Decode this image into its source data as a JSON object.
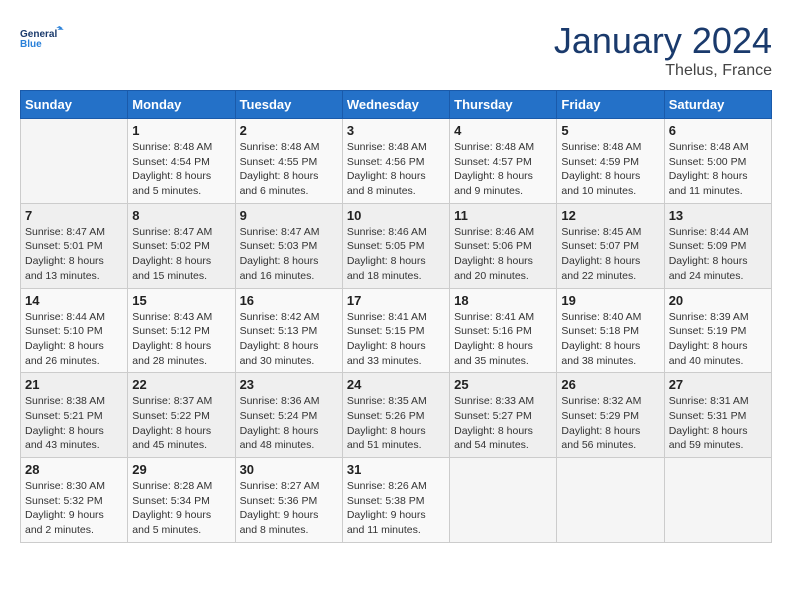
{
  "header": {
    "logo_line1": "General",
    "logo_line2": "Blue",
    "month": "January 2024",
    "location": "Thelus, France"
  },
  "weekdays": [
    "Sunday",
    "Monday",
    "Tuesday",
    "Wednesday",
    "Thursday",
    "Friday",
    "Saturday"
  ],
  "weeks": [
    [
      {
        "day": "",
        "sunrise": "",
        "sunset": "",
        "daylight": ""
      },
      {
        "day": "1",
        "sunrise": "Sunrise: 8:48 AM",
        "sunset": "Sunset: 4:54 PM",
        "daylight": "Daylight: 8 hours and 5 minutes."
      },
      {
        "day": "2",
        "sunrise": "Sunrise: 8:48 AM",
        "sunset": "Sunset: 4:55 PM",
        "daylight": "Daylight: 8 hours and 6 minutes."
      },
      {
        "day": "3",
        "sunrise": "Sunrise: 8:48 AM",
        "sunset": "Sunset: 4:56 PM",
        "daylight": "Daylight: 8 hours and 8 minutes."
      },
      {
        "day": "4",
        "sunrise": "Sunrise: 8:48 AM",
        "sunset": "Sunset: 4:57 PM",
        "daylight": "Daylight: 8 hours and 9 minutes."
      },
      {
        "day": "5",
        "sunrise": "Sunrise: 8:48 AM",
        "sunset": "Sunset: 4:59 PM",
        "daylight": "Daylight: 8 hours and 10 minutes."
      },
      {
        "day": "6",
        "sunrise": "Sunrise: 8:48 AM",
        "sunset": "Sunset: 5:00 PM",
        "daylight": "Daylight: 8 hours and 11 minutes."
      }
    ],
    [
      {
        "day": "7",
        "sunrise": "Sunrise: 8:47 AM",
        "sunset": "Sunset: 5:01 PM",
        "daylight": "Daylight: 8 hours and 13 minutes."
      },
      {
        "day": "8",
        "sunrise": "Sunrise: 8:47 AM",
        "sunset": "Sunset: 5:02 PM",
        "daylight": "Daylight: 8 hours and 15 minutes."
      },
      {
        "day": "9",
        "sunrise": "Sunrise: 8:47 AM",
        "sunset": "Sunset: 5:03 PM",
        "daylight": "Daylight: 8 hours and 16 minutes."
      },
      {
        "day": "10",
        "sunrise": "Sunrise: 8:46 AM",
        "sunset": "Sunset: 5:05 PM",
        "daylight": "Daylight: 8 hours and 18 minutes."
      },
      {
        "day": "11",
        "sunrise": "Sunrise: 8:46 AM",
        "sunset": "Sunset: 5:06 PM",
        "daylight": "Daylight: 8 hours and 20 minutes."
      },
      {
        "day": "12",
        "sunrise": "Sunrise: 8:45 AM",
        "sunset": "Sunset: 5:07 PM",
        "daylight": "Daylight: 8 hours and 22 minutes."
      },
      {
        "day": "13",
        "sunrise": "Sunrise: 8:44 AM",
        "sunset": "Sunset: 5:09 PM",
        "daylight": "Daylight: 8 hours and 24 minutes."
      }
    ],
    [
      {
        "day": "14",
        "sunrise": "Sunrise: 8:44 AM",
        "sunset": "Sunset: 5:10 PM",
        "daylight": "Daylight: 8 hours and 26 minutes."
      },
      {
        "day": "15",
        "sunrise": "Sunrise: 8:43 AM",
        "sunset": "Sunset: 5:12 PM",
        "daylight": "Daylight: 8 hours and 28 minutes."
      },
      {
        "day": "16",
        "sunrise": "Sunrise: 8:42 AM",
        "sunset": "Sunset: 5:13 PM",
        "daylight": "Daylight: 8 hours and 30 minutes."
      },
      {
        "day": "17",
        "sunrise": "Sunrise: 8:41 AM",
        "sunset": "Sunset: 5:15 PM",
        "daylight": "Daylight: 8 hours and 33 minutes."
      },
      {
        "day": "18",
        "sunrise": "Sunrise: 8:41 AM",
        "sunset": "Sunset: 5:16 PM",
        "daylight": "Daylight: 8 hours and 35 minutes."
      },
      {
        "day": "19",
        "sunrise": "Sunrise: 8:40 AM",
        "sunset": "Sunset: 5:18 PM",
        "daylight": "Daylight: 8 hours and 38 minutes."
      },
      {
        "day": "20",
        "sunrise": "Sunrise: 8:39 AM",
        "sunset": "Sunset: 5:19 PM",
        "daylight": "Daylight: 8 hours and 40 minutes."
      }
    ],
    [
      {
        "day": "21",
        "sunrise": "Sunrise: 8:38 AM",
        "sunset": "Sunset: 5:21 PM",
        "daylight": "Daylight: 8 hours and 43 minutes."
      },
      {
        "day": "22",
        "sunrise": "Sunrise: 8:37 AM",
        "sunset": "Sunset: 5:22 PM",
        "daylight": "Daylight: 8 hours and 45 minutes."
      },
      {
        "day": "23",
        "sunrise": "Sunrise: 8:36 AM",
        "sunset": "Sunset: 5:24 PM",
        "daylight": "Daylight: 8 hours and 48 minutes."
      },
      {
        "day": "24",
        "sunrise": "Sunrise: 8:35 AM",
        "sunset": "Sunset: 5:26 PM",
        "daylight": "Daylight: 8 hours and 51 minutes."
      },
      {
        "day": "25",
        "sunrise": "Sunrise: 8:33 AM",
        "sunset": "Sunset: 5:27 PM",
        "daylight": "Daylight: 8 hours and 54 minutes."
      },
      {
        "day": "26",
        "sunrise": "Sunrise: 8:32 AM",
        "sunset": "Sunset: 5:29 PM",
        "daylight": "Daylight: 8 hours and 56 minutes."
      },
      {
        "day": "27",
        "sunrise": "Sunrise: 8:31 AM",
        "sunset": "Sunset: 5:31 PM",
        "daylight": "Daylight: 8 hours and 59 minutes."
      }
    ],
    [
      {
        "day": "28",
        "sunrise": "Sunrise: 8:30 AM",
        "sunset": "Sunset: 5:32 PM",
        "daylight": "Daylight: 9 hours and 2 minutes."
      },
      {
        "day": "29",
        "sunrise": "Sunrise: 8:28 AM",
        "sunset": "Sunset: 5:34 PM",
        "daylight": "Daylight: 9 hours and 5 minutes."
      },
      {
        "day": "30",
        "sunrise": "Sunrise: 8:27 AM",
        "sunset": "Sunset: 5:36 PM",
        "daylight": "Daylight: 9 hours and 8 minutes."
      },
      {
        "day": "31",
        "sunrise": "Sunrise: 8:26 AM",
        "sunset": "Sunset: 5:38 PM",
        "daylight": "Daylight: 9 hours and 11 minutes."
      },
      {
        "day": "",
        "sunrise": "",
        "sunset": "",
        "daylight": ""
      },
      {
        "day": "",
        "sunrise": "",
        "sunset": "",
        "daylight": ""
      },
      {
        "day": "",
        "sunrise": "",
        "sunset": "",
        "daylight": ""
      }
    ]
  ]
}
